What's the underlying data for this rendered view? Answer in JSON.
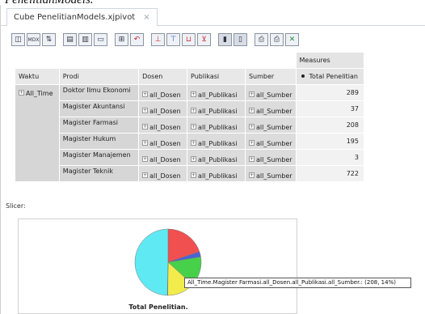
{
  "caption": "PenelitianModels.",
  "tab": {
    "title": "Cube PenelitianModels.xjpivot",
    "close": "×"
  },
  "toolbar": {
    "buttons": [
      {
        "name": "cube-navigator-icon",
        "glyph": "◫"
      },
      {
        "name": "mdx-icon",
        "glyph": "MDX"
      },
      {
        "name": "sort-icon",
        "glyph": "⇅"
      },
      {
        "name": "show-parent-members-icon",
        "glyph": "▤"
      },
      {
        "name": "hide-spans-icon",
        "glyph": "▥"
      },
      {
        "name": "show-properties-icon",
        "glyph": "▭"
      },
      {
        "name": "suppress-empty-icon",
        "glyph": "⊞"
      },
      {
        "name": "swap-axes-icon",
        "glyph": "↶"
      },
      {
        "name": "drill-member-icon",
        "glyph": "⊥"
      },
      {
        "name": "drill-position-icon",
        "glyph": "⊤"
      },
      {
        "name": "drill-replace-icon",
        "glyph": "⊔"
      },
      {
        "name": "drill-through-icon",
        "glyph": "⊻"
      },
      {
        "name": "show-chart-icon",
        "glyph": "▮"
      },
      {
        "name": "chart-config-icon",
        "glyph": "▯"
      },
      {
        "name": "print-config-icon",
        "glyph": "⎙"
      },
      {
        "name": "print-pdf-icon",
        "glyph": "⎙"
      },
      {
        "name": "export-excel-icon",
        "glyph": "✕"
      }
    ]
  },
  "pivot": {
    "measures_label": "Measures",
    "headers": [
      "Waktu",
      "Prodi",
      "Dosen",
      "Publikasi",
      "Sumber"
    ],
    "measure_name": "Total Penelitian",
    "waktu_member": "All_Time",
    "rows": [
      {
        "prodi": "Doktor Ilmu Ekonomi",
        "dosen": "all_Dosen",
        "publikasi": "all_Publikasi",
        "sumber": "all_Sumber",
        "value": "289"
      },
      {
        "prodi": "Magister Akuntansi",
        "dosen": "all_Dosen",
        "publikasi": "all_Publikasi",
        "sumber": "all_Sumber",
        "value": "37"
      },
      {
        "prodi": "Magister Farmasi",
        "dosen": "all_Dosen",
        "publikasi": "all_Publikasi",
        "sumber": "all_Sumber",
        "value": "208"
      },
      {
        "prodi": "Magister Hukum",
        "dosen": "all_Dosen",
        "publikasi": "all_Publikasi",
        "sumber": "all_Sumber",
        "value": "195"
      },
      {
        "prodi": "Magister Manajemen",
        "dosen": "all_Dosen",
        "publikasi": "all_Publikasi",
        "sumber": "all_Sumber",
        "value": "3"
      },
      {
        "prodi": "Magister Teknik",
        "dosen": "all_Dosen",
        "publikasi": "all_Publikasi",
        "sumber": "all_Sumber",
        "value": "722"
      }
    ]
  },
  "slicer": {
    "label": "Slicer:"
  },
  "chart_data": {
    "type": "pie",
    "title": "Total Penelitian.",
    "categories": [
      "Doktor Ilmu Ekonomi",
      "Magister Akuntansi",
      "Magister Farmasi",
      "Magister Hukum",
      "Magister Manajemen",
      "Magister Teknik"
    ],
    "values": [
      289,
      37,
      208,
      195,
      3,
      722
    ],
    "colors": [
      "#f05050",
      "#4a63d8",
      "#47d14a",
      "#f1ec4c",
      "#d349cf",
      "#5fe9f3"
    ],
    "tooltip": "All_Time.Magister Farmasi.all_Dosen.all_Publikasi.all_Sumber.: (208, 14%)"
  }
}
